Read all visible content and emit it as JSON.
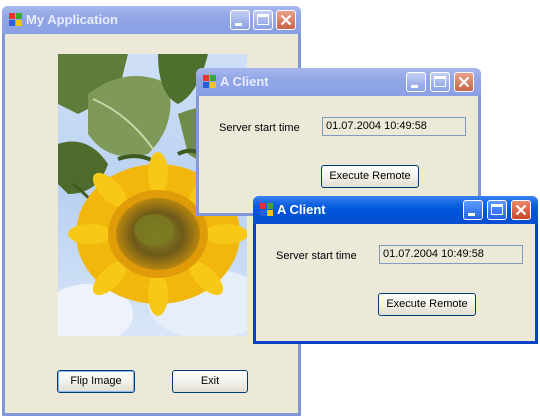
{
  "main_window": {
    "title": "My Application",
    "flip_label": "Flip Image",
    "exit_label": "Exit",
    "image_icon": "sunflower-image"
  },
  "clients": [
    {
      "title": "A Client",
      "label": "Server start time",
      "value": "01.07.2004 10:49:58",
      "button": "Execute Remote",
      "state": "inactive"
    },
    {
      "title": "A Client",
      "label": "Server start time",
      "value": "01.07.2004 10:49:58",
      "button": "Execute Remote",
      "state": "active"
    }
  ],
  "colors": {
    "active_title": "#0a5fe0",
    "inactive_title": "#8aa0e4",
    "window_bg": "#ece9d8"
  },
  "icons": [
    "app-icon",
    "minimize-icon",
    "maximize-icon",
    "close-icon"
  ]
}
